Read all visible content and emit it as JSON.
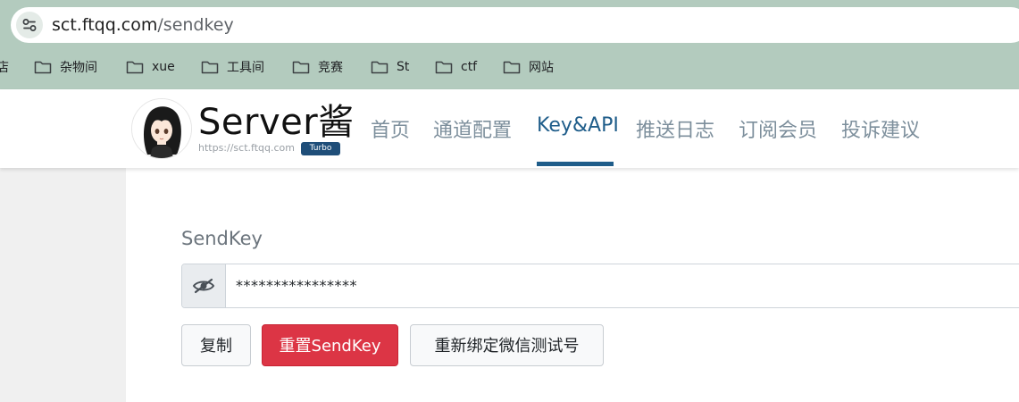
{
  "browser": {
    "url_host": "sct.ftqq.com",
    "url_path": "/sendkey",
    "bookmarks": [
      "店",
      "杂物间",
      "xue",
      "工具间",
      "竞赛",
      "St",
      "ctf",
      "网站"
    ]
  },
  "site": {
    "title": "Server酱",
    "url": "https://sct.ftqq.com",
    "badge": "Turbo",
    "nav": [
      "首页",
      "通道配置",
      "Key&API",
      "推送日志",
      "订阅会员",
      "投诉建议"
    ],
    "active_nav": "Key&API"
  },
  "sendkey": {
    "label": "SendKey",
    "masked_value": "****************",
    "buttons": {
      "copy": "复制",
      "reset": "重置SendKey",
      "rebind": "重新绑定微信测试号"
    }
  },
  "colors": {
    "chrome_bg": "#b3cbbe",
    "nav_active": "#1f5d8a",
    "danger": "#dc3545"
  },
  "icons": [
    "tune-icon",
    "folder-icon",
    "eye-slash-icon"
  ]
}
